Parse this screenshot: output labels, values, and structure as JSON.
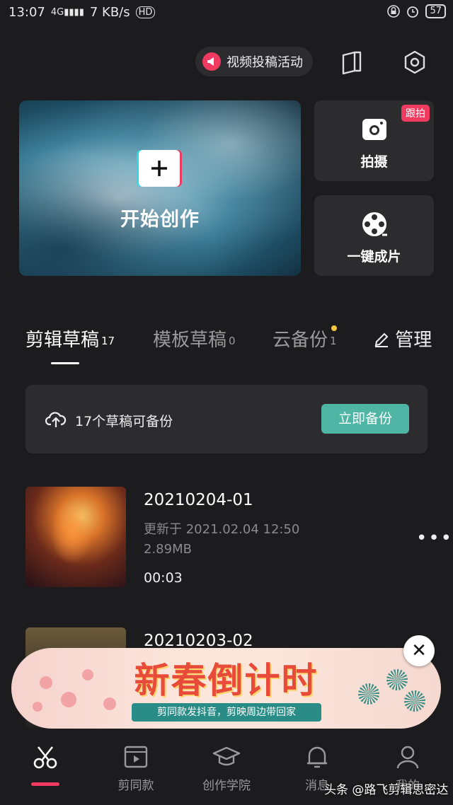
{
  "status_bar": {
    "time": "13:07",
    "network": "4G",
    "speed": "7 KB/s",
    "hd": "HD",
    "battery": "57"
  },
  "topbar": {
    "event_label": "视频投稿活动",
    "icons": [
      "tutorial-book-icon",
      "settings-hex-icon"
    ]
  },
  "hero": {
    "label": "开始创作"
  },
  "side_cards": [
    {
      "label": "拍摄",
      "badge": "跟拍",
      "icon": "camera-icon"
    },
    {
      "label": "一键成片",
      "icon": "film-reel-icon"
    }
  ],
  "tabs": [
    {
      "label": "剪辑草稿",
      "count": "17",
      "active": true
    },
    {
      "label": "模板草稿",
      "count": "0",
      "active": false
    },
    {
      "label": "云备份",
      "count": "1",
      "active": false
    },
    {
      "label": "管理",
      "icon": "edit-icon"
    }
  ],
  "backup": {
    "text": "17个草稿可备份",
    "button": "立即备份"
  },
  "drafts": [
    {
      "title": "20210204-01",
      "updated": "更新于 2021.02.04 12:50",
      "size": "2.89MB",
      "duration": "00:03"
    },
    {
      "title": "20210203-02"
    }
  ],
  "banner": {
    "title": "新春倒计时",
    "subtitle": "剪同款发抖音，剪映周边带回家",
    "close": "✕"
  },
  "nav": [
    {
      "label": "",
      "icon": "scissors-icon",
      "active": true
    },
    {
      "label": "剪同款",
      "icon": "template-video-icon"
    },
    {
      "label": "创作学院",
      "icon": "graduation-cap-icon"
    },
    {
      "label": "消息",
      "icon": "bell-icon"
    },
    {
      "label": "我的",
      "icon": "user-icon"
    }
  ],
  "watermark": "头条 @路飞剪辑思密达",
  "colors": {
    "background": "#1c1c1e",
    "accent": "#f03a5f",
    "teal": "#4fb5a5",
    "card": "#2c2c2e"
  }
}
